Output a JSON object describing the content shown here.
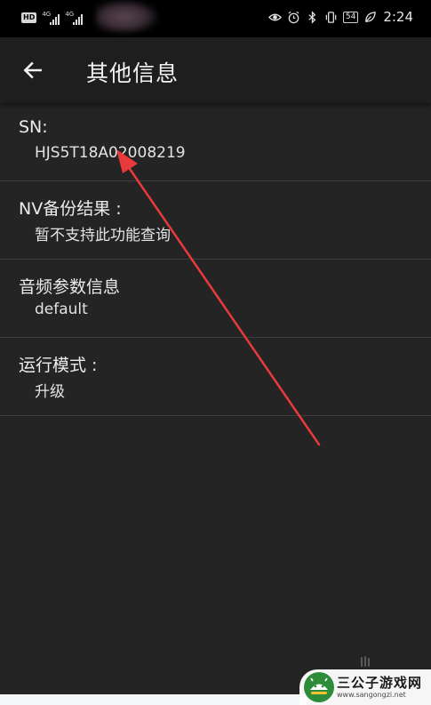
{
  "status_bar": {
    "hd": "HD",
    "net1": "4G",
    "net2": "4G",
    "battery": "54",
    "time": "2:24"
  },
  "app_bar": {
    "title": "其他信息",
    "back_icon": "arrow-left-icon"
  },
  "items": [
    {
      "label": "SN:",
      "value": "HJS5T18A02008219"
    },
    {
      "label": "NV备份结果 :",
      "value": "暂不支持此功能查询"
    },
    {
      "label": "音频参数信息",
      "value": "default"
    },
    {
      "label": "运行模式 :",
      "value": "升级"
    }
  ],
  "watermark": {
    "title": "三公子游戏网",
    "url": "www.sangongzi.net"
  },
  "colors": {
    "background": "#242424",
    "app_bar": "#1e1e1e",
    "annotation_arrow": "#e83a3a"
  }
}
